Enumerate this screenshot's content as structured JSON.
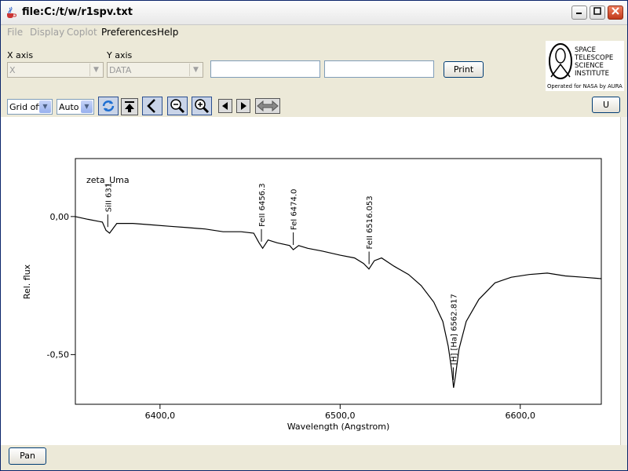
{
  "window": {
    "title": "file:C:/t/w/r1spv.txt"
  },
  "menu": {
    "file": "File",
    "display": "Display",
    "coplot": "Coplot",
    "preferences": "Preferences",
    "help": "Help"
  },
  "toolbar": {
    "x_axis_label": "X axis",
    "y_axis_label": "Y axis",
    "x_axis_value": "X",
    "y_axis_value": "DATA",
    "print_label": "Print",
    "u_label": "U",
    "grid_value": "Grid off",
    "scale_value": "Auto"
  },
  "logo": {
    "lines": [
      "SPACE",
      "TELESCOPE",
      "SCIENCE",
      "INSTITUTE"
    ],
    "caption": "Operated for NASA by AURA"
  },
  "footer": {
    "pan_label": "Pan"
  },
  "chart_data": {
    "type": "line",
    "xlabel": "Wavelength (Angstrom)",
    "ylabel": "Rel. flux",
    "xlim": [
      6353,
      6645
    ],
    "ylim": [
      -0.68,
      0.21
    ],
    "x_ticks": [
      "6400,0",
      "6500,0",
      "6600,0"
    ],
    "x_tick_values": [
      6400,
      6500,
      6600
    ],
    "y_ticks": [
      "0,00",
      "-0,50"
    ],
    "y_tick_values": [
      0.0,
      -0.5
    ],
    "grid": false,
    "series": [
      {
        "x": [
          6353,
          6360,
          6368,
          6370,
          6372,
          6376,
          6385,
          6395,
          6405,
          6415,
          6425,
          6435,
          6445,
          6452,
          6455,
          6457,
          6460,
          6465,
          6472,
          6474,
          6477,
          6482,
          6490,
          6500,
          6508,
          6513,
          6516,
          6519,
          6523,
          6530,
          6538,
          6545,
          6552,
          6557,
          6560,
          6562,
          6563,
          6564,
          6566,
          6570,
          6577,
          6586,
          6595,
          6605,
          6615,
          6625,
          6635,
          6645
        ],
        "y": [
          0.0,
          -0.01,
          -0.02,
          -0.05,
          -0.06,
          -0.025,
          -0.025,
          -0.03,
          -0.035,
          -0.04,
          -0.045,
          -0.055,
          -0.055,
          -0.06,
          -0.095,
          -0.115,
          -0.085,
          -0.095,
          -0.105,
          -0.12,
          -0.105,
          -0.115,
          -0.125,
          -0.14,
          -0.15,
          -0.17,
          -0.19,
          -0.16,
          -0.15,
          -0.18,
          -0.21,
          -0.25,
          -0.31,
          -0.38,
          -0.47,
          -0.56,
          -0.62,
          -0.58,
          -0.48,
          -0.38,
          -0.3,
          -0.24,
          -0.22,
          -0.21,
          -0.205,
          -0.215,
          -0.22,
          -0.225
        ]
      }
    ],
    "annotations": [
      {
        "x": 6371,
        "text": "SiII",
        "value": "631"
      },
      {
        "x": 6456.3,
        "text": "FeII",
        "value": "6456.3"
      },
      {
        "x": 6474,
        "text": "FeI",
        "value": "6474.0"
      },
      {
        "x": 6516.053,
        "text": "FeII",
        "value": "6516.053"
      },
      {
        "x": 6562.817,
        "text": "[H]",
        "label2": "[Ha]",
        "value": "6562.817"
      }
    ],
    "object_label": "zeta_Uma"
  }
}
